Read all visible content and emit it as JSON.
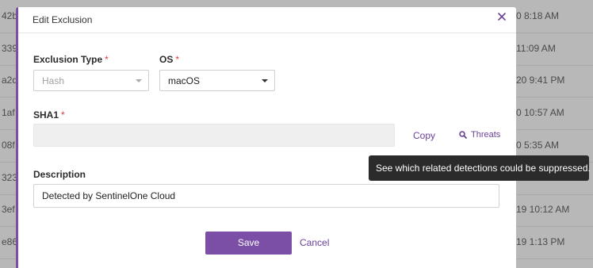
{
  "background_table": {
    "rows": [
      {
        "id_fragment": "42b",
        "time": "0 8:18 AM"
      },
      {
        "id_fragment": "339",
        "time": "11:09 AM"
      },
      {
        "id_fragment": "a2d",
        "time": "20 9:41 PM"
      },
      {
        "id_fragment": "1af",
        "time": "0 10:57 AM"
      },
      {
        "id_fragment": "08f",
        "time": "0 5:35 AM"
      },
      {
        "id_fragment": "323",
        "time": ""
      },
      {
        "id_fragment": "3ef",
        "time": "19 10:12 AM"
      },
      {
        "id_fragment": "e86",
        "time": "19 1:13 PM"
      }
    ]
  },
  "modal": {
    "title": "Edit Exclusion",
    "close_icon": "close-icon",
    "exclusion_type": {
      "label": "Exclusion Type",
      "required_mark": "*",
      "value": "Hash"
    },
    "os": {
      "label": "OS",
      "required_mark": "*",
      "value": "macOS"
    },
    "sha1": {
      "label": "SHA1",
      "required_mark": "*",
      "value": ""
    },
    "copy_label": "Copy",
    "threats_label": "Threats",
    "threats_icon": "search-icon",
    "tooltip": "See which related detections could be suppressed.",
    "description": {
      "label": "Description",
      "value": "Detected by SentinelOne Cloud"
    },
    "save_label": "Save",
    "cancel_label": "Cancel"
  },
  "colors": {
    "accent": "#7b4fa6",
    "required": "#d83a3a",
    "tooltip_bg": "#2b2b2b"
  }
}
